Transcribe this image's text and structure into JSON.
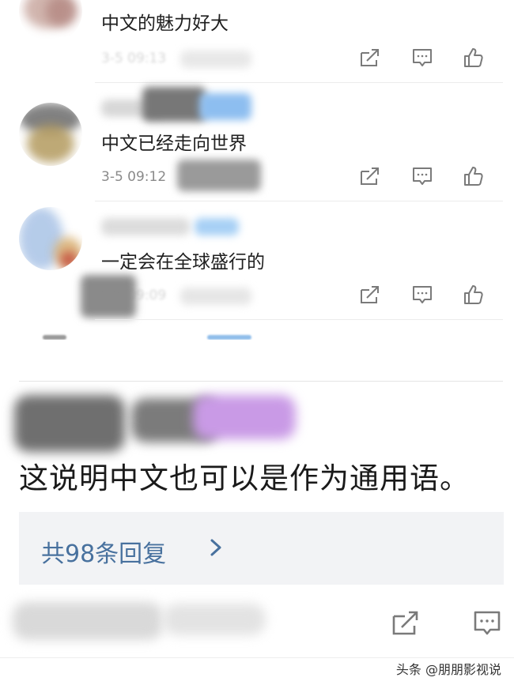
{
  "comments": [
    {
      "text": "中文的魅力好大",
      "time": "3-5 09:13"
    },
    {
      "text": "中文已经走向世界",
      "time": "3-5 09:12"
    },
    {
      "text": "一定会在全球盛行的",
      "time": "3-5 09:09"
    }
  ],
  "icons": {
    "share": "share-icon",
    "comment": "comment-icon",
    "like": "thumbs-up-icon",
    "chevron": "chevron-right-icon"
  },
  "post": {
    "text": "这说明中文也可以是作为通用语。",
    "reply_count": "共98条回复"
  },
  "watermark": "头条 @朋朋影视说",
  "colors": {
    "link": "#48719e",
    "icon": "#7a7a7a",
    "reply_bg": "#f2f3f5"
  }
}
